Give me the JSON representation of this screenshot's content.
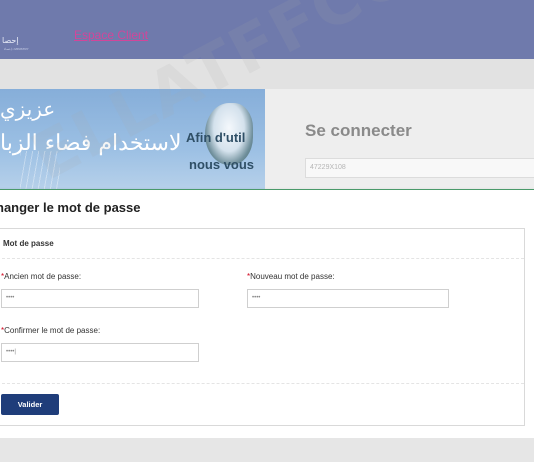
{
  "header": {
    "logo_text": "إحصا",
    "logo_subtext": "إحصاء • MINISTRY",
    "espace_link": "Espace Client"
  },
  "banner": {
    "arabic_line1": "عزيزي",
    "arabic_line2": "لاستخدام فضاء الزبا",
    "french_line1": "Afin d'util",
    "french_line2": "nous vous"
  },
  "login": {
    "title": "Se connecter",
    "username_value": "47229X108"
  },
  "modal": {
    "title": "hanger le mot de passe",
    "legend": "Mot de passe",
    "ancien_label": "Ancien mot de passe:",
    "ancien_value": "••••",
    "nouveau_label": "Nouveau mot de passe:",
    "nouveau_value": "••••",
    "confirm_label": "Confirmer le mot de passe:",
    "confirm_value": "••••|",
    "required_marker": "*",
    "submit_label": "Valider"
  },
  "watermark": "ELLATFFCOZ.COM",
  "colors": {
    "topbar": "#6f7aac",
    "link": "#d2469a",
    "button": "#1f3d7a",
    "required": "#d0021b",
    "modal_border": "#4a9a6a"
  }
}
